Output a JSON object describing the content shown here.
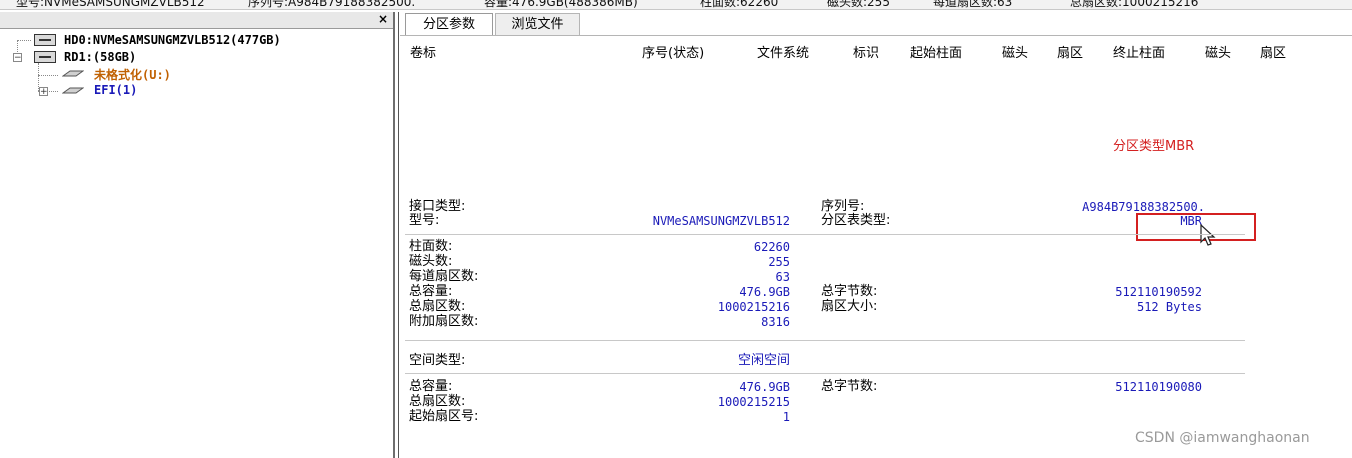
{
  "status_bar": {
    "model": "型号:NVMeSAMSUNGMZVLB512",
    "serial": "序列号:A984B79188382500.",
    "capacity": "容量:476.9GB(488386MB)",
    "cylinders": "柱面数:62260",
    "heads": "磁头数:255",
    "sectors_per_track": "每道扇区数:63",
    "total_sectors": "总扇区数:1000215216"
  },
  "left_pane": {
    "close_symbol": "×",
    "tree": [
      {
        "label": "HD0:NVMeSAMSUNGMZVLB512(477GB)"
      },
      {
        "label": "RD1:(58GB)",
        "expander": "−"
      },
      {
        "label": "未格式化(U:)",
        "color": "#c06000"
      },
      {
        "label": "EFI(1)",
        "expander": "+",
        "color": "#1a1ab8"
      }
    ]
  },
  "tabs": [
    {
      "label": "分区参数"
    },
    {
      "label": "浏览文件"
    }
  ],
  "partition_table": {
    "columns": [
      "卷标",
      "序号(状态)",
      "文件系统",
      "标识",
      "起始柱面",
      "磁头",
      "扇区",
      "终止柱面",
      "磁头",
      "扇区"
    ]
  },
  "disk_info": {
    "interface_label": "接口类型:",
    "model_label": "型号:",
    "model_value": "NVMeSAMSUNGMZVLB512",
    "serial_label": "序列号:",
    "serial_value": "A984B79188382500.",
    "ptable_label": "分区表类型:",
    "ptable_value": "MBR",
    "cylinders_label": "柱面数:",
    "cylinders_value": "62260",
    "heads_label": "磁头数:",
    "heads_value": "255",
    "spt_label": "每道扇区数:",
    "spt_value": "63",
    "capacity_label": "总容量:",
    "capacity_value": "476.9GB",
    "total_sectors_label": "总扇区数:",
    "total_sectors_value": "1000215216",
    "extra_sectors_label": "附加扇区数:",
    "extra_sectors_value": "8316",
    "total_bytes_label": "总字节数:",
    "total_bytes_value": "512110190592",
    "sector_size_label": "扇区大小:",
    "sector_size_value": "512 Bytes"
  },
  "space_info": {
    "type_label": "空间类型:",
    "type_value": "空闲空间",
    "capacity_label": "总容量:",
    "capacity_value": "476.9GB",
    "total_sectors_label": "总扇区数:",
    "total_sectors_value": "1000215215",
    "start_sector_label": "起始扇区号:",
    "start_sector_value": "1",
    "total_bytes_label": "总字节数:",
    "total_bytes_value": "512110190080"
  },
  "annotation": {
    "text": "分区类型MBR",
    "color": "#d42020"
  },
  "watermark": "CSDN @iamwanghaonan"
}
